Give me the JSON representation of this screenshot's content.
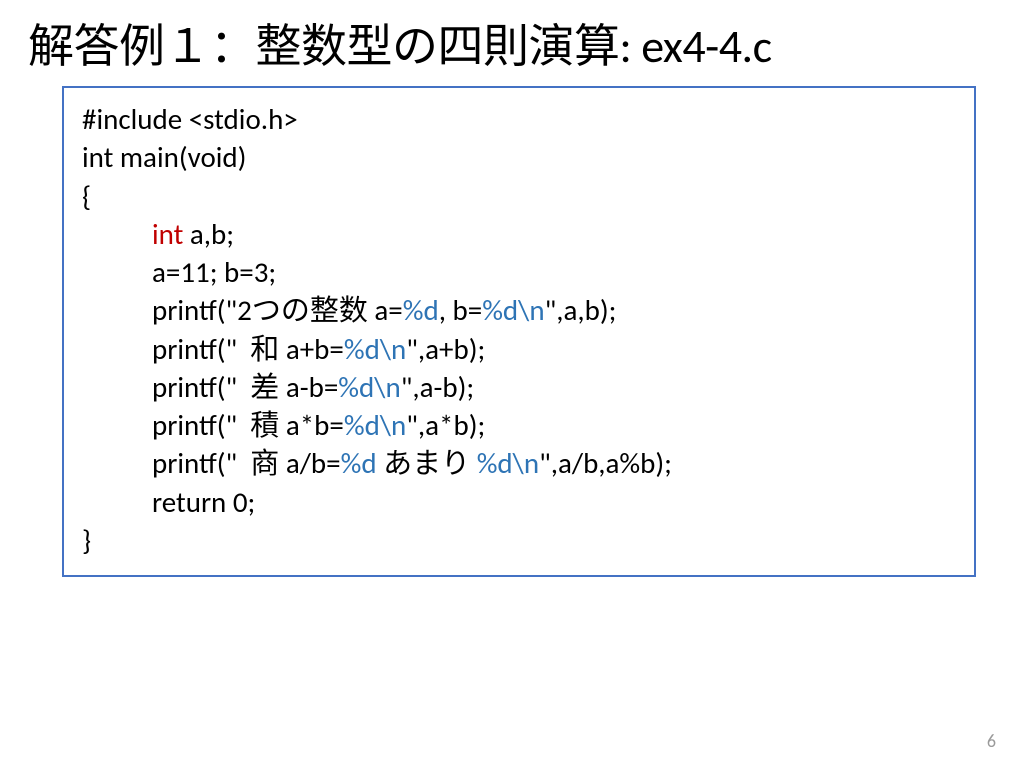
{
  "title": "解答例１：整数型の四則演算: ex4-4.c",
  "code": {
    "l1": "#include <stdio.h>",
    "l2": "",
    "l3": "int main(void)",
    "l4": "{",
    "l5_a": "int",
    "l5_b": " a,b;",
    "l6": "a=11; b=3;",
    "l7": "",
    "l8_a": "printf(\"2",
    "l8_b": "つの整数",
    "l8_c": " a=",
    "l8_d": "%d",
    "l8_e": ", b=",
    "l8_f": "%d\\n",
    "l8_g": "\",a,b);",
    "l9_a": "printf(\"  ",
    "l9_b": "和",
    "l9_c": " a+b=",
    "l9_d": "%d\\n",
    "l9_e": "\",a+b);",
    "l10_a": "printf(\"  ",
    "l10_b": "差",
    "l10_c": " a-b=",
    "l10_d": "%d\\n",
    "l10_e": "\",a-b);",
    "l11_a": "printf(\"  ",
    "l11_b": "積",
    "l11_c": " a*b=",
    "l11_d": "%d\\n",
    "l11_e": "\",a*b);",
    "l12_a": "printf(\"  ",
    "l12_b": "商",
    "l12_c": " a/b=",
    "l12_d": "%d",
    "l12_e": " あまり ",
    "l12_f": "%d\\n",
    "l12_g": "\",a/b,a%b);",
    "l13": "return 0;",
    "l14": "}"
  },
  "page_number": "6"
}
